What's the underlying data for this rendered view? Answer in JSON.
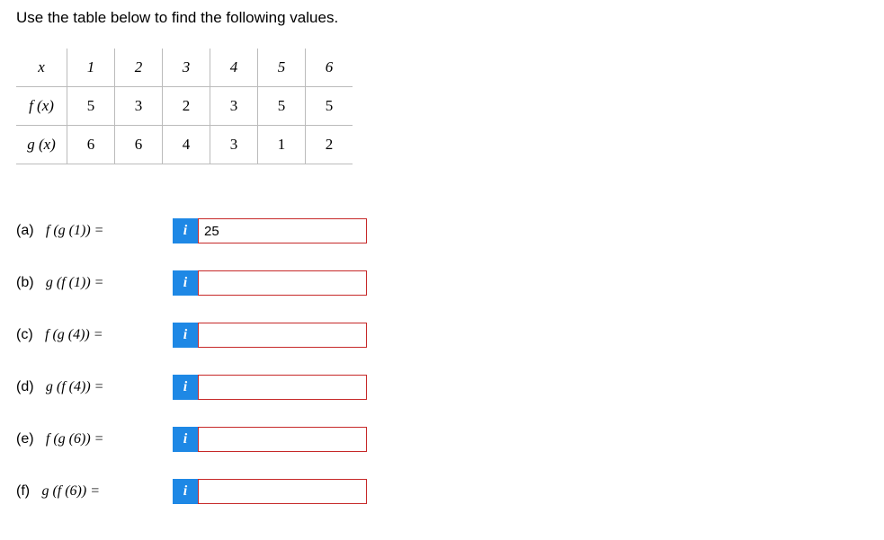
{
  "instruction": "Use the table below to find the following values.",
  "table": {
    "header_row": [
      "x",
      "1",
      "2",
      "3",
      "4",
      "5",
      "6"
    ],
    "f_row": [
      "f (x)",
      "5",
      "3",
      "2",
      "3",
      "5",
      "5"
    ],
    "g_row": [
      "g (x)",
      "6",
      "6",
      "4",
      "3",
      "1",
      "2"
    ]
  },
  "info_label": "i",
  "questions": {
    "a": {
      "part": "(a)",
      "expr": "f (g (1)) =",
      "value": "25"
    },
    "b": {
      "part": "(b)",
      "expr": "g (f (1)) =",
      "value": ""
    },
    "c": {
      "part": "(c)",
      "expr": "f (g (4)) =",
      "value": ""
    },
    "d": {
      "part": "(d)",
      "expr": "g (f (4)) =",
      "value": ""
    },
    "e": {
      "part": "(e)",
      "expr": "f (g (6)) =",
      "value": ""
    },
    "f": {
      "part": "(f)",
      "expr": "g (f (6)) =",
      "value": ""
    }
  }
}
